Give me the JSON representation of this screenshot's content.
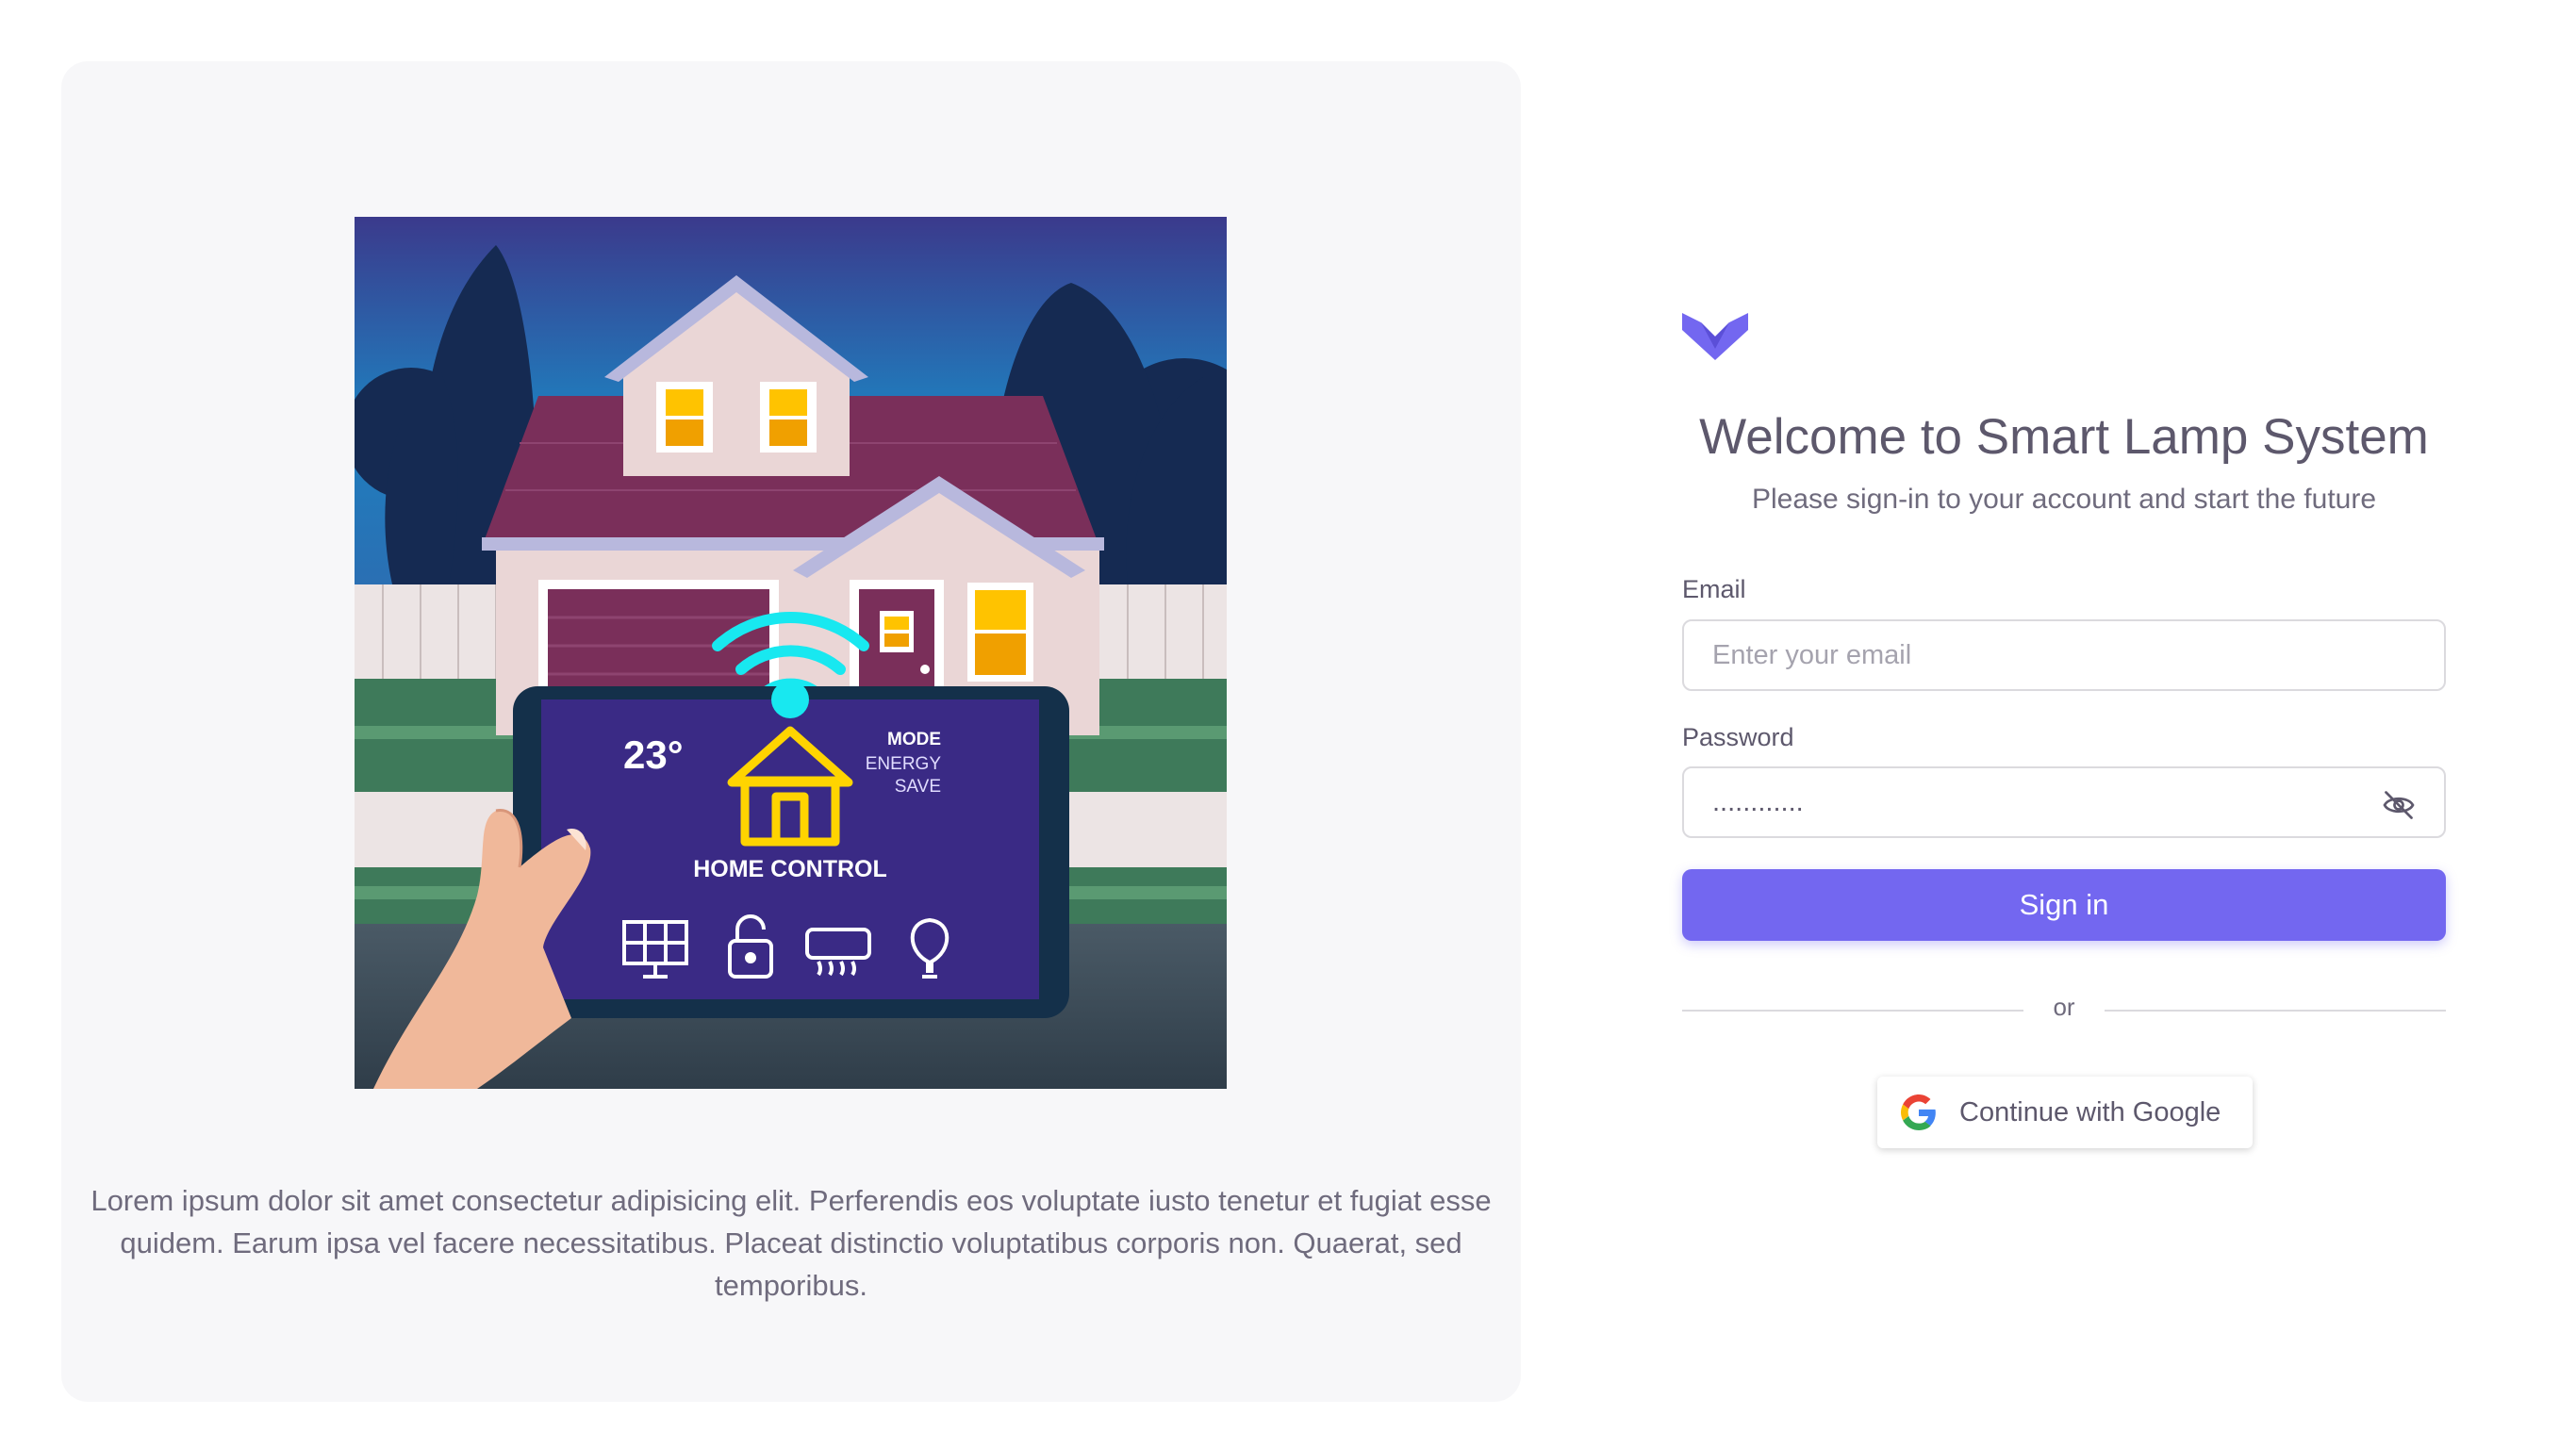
{
  "hero": {
    "lorem": "Lorem ipsum dolor sit amet consectetur adipisicing elit. Perferendis eos voluptate iusto tenetur et fugiat esse quidem. Earum ipsa vel facere necessitatibus. Placeat distinctio voluptatibus corporis non. Quaerat, sed temporibus.",
    "tablet": {
      "temperature": "23°",
      "mode_title": "MODE",
      "mode_line1": "ENERGY",
      "mode_line2": "SAVE",
      "caption": "HOME CONTROL"
    }
  },
  "login": {
    "title": "Welcome to Smart Lamp System",
    "subtitle": "Please sign-in to your account and start the future",
    "email_label": "Email",
    "email_placeholder": "Enter your email",
    "password_label": "Password",
    "password_value": "............",
    "signin_label": "Sign in",
    "divider_text": "or",
    "google_label": "Continue with Google"
  },
  "colors": {
    "primary": "#7367f0",
    "panel_bg": "#f7f7f9",
    "text": "#5d586c"
  },
  "icons": [
    "logo-icon",
    "eye-off-icon",
    "google-icon",
    "wifi-icon",
    "house-icon",
    "solar-panel-icon",
    "lock-icon",
    "air-conditioner-icon",
    "bulb-icon"
  ]
}
